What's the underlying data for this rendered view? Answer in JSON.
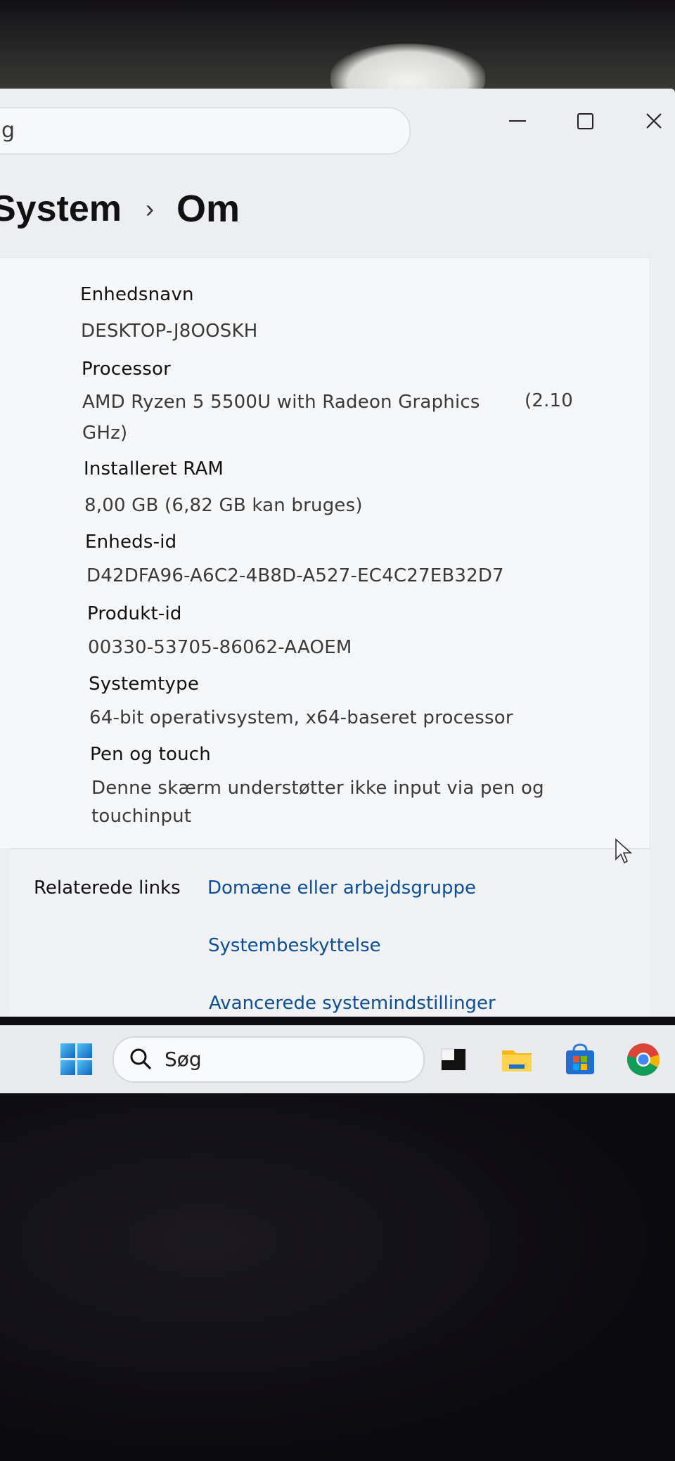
{
  "window": {
    "search_partial_text": "g",
    "breadcrumb": {
      "parent": "System",
      "separator": "›",
      "current": "Om"
    }
  },
  "specs": [
    {
      "label": "Enhedsnavn",
      "value": "DESKTOP-J8OOSKH"
    },
    {
      "label": "Processor",
      "value": "AMD Ryzen 5 5500U with Radeon Graphics",
      "value_extra": "(2.10",
      "value_line2": "GHz)"
    },
    {
      "label": "Installeret RAM",
      "value": "8,00 GB (6,82 GB kan bruges)"
    },
    {
      "label": "Enheds-id",
      "value": "D42DFA96-A6C2-4B8D-A527-EC4C27EB32D7"
    },
    {
      "label": "Produkt-id",
      "value": "00330-53705-86062-AAOEM"
    },
    {
      "label": "Systemtype",
      "value": "64-bit operativsystem, x64-baseret processor"
    },
    {
      "label": "Pen og touch",
      "value": "Denne skærm understøtter ikke input via pen og",
      "value_line2": "touchinput"
    }
  ],
  "related": {
    "title": "Relaterede links",
    "links": [
      "Domæne eller arbejdsgruppe",
      "Systembeskyttelse",
      "Avancerede systemindstillinger"
    ]
  },
  "taskbar": {
    "search_placeholder": "Søg",
    "apps": [
      "start-icon",
      "task-view-icon",
      "file-explorer-icon",
      "microsoft-store-icon",
      "chrome-icon"
    ]
  },
  "colors": {
    "link": "#0b4f9c",
    "window_bg": "#eceef2",
    "taskbar_bg": "#e9ebef"
  }
}
